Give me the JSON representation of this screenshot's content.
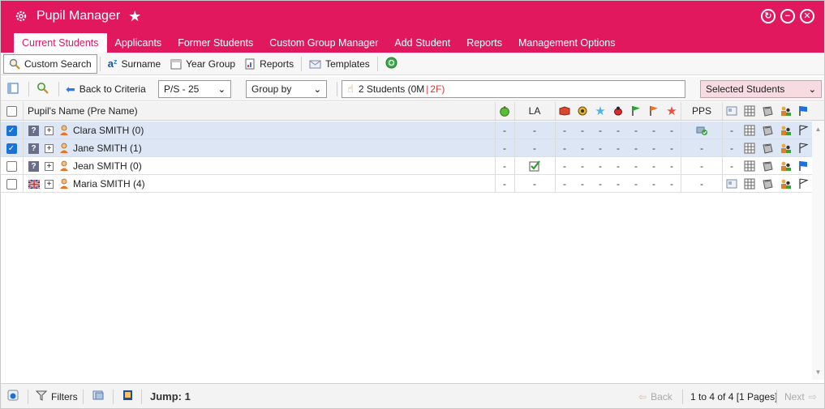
{
  "window": {
    "title": "Pupil Manager",
    "controls": [
      "refresh-icon",
      "minimize-icon",
      "close-icon"
    ]
  },
  "tabs": [
    {
      "label": "Current Students",
      "active": true
    },
    {
      "label": "Applicants"
    },
    {
      "label": "Former Students"
    },
    {
      "label": "Custom Group Manager"
    },
    {
      "label": "Add Student"
    },
    {
      "label": "Reports"
    },
    {
      "label": "Management Options"
    }
  ],
  "toolbar": {
    "custom_search": "Custom Search",
    "surname": "Surname",
    "year_group": "Year Group",
    "reports": "Reports",
    "templates": "Templates",
    "year_icon_text": "12"
  },
  "toolbar2": {
    "back_to_criteria": "Back to Criteria",
    "class_select": "P/S - 25",
    "group_by": "Group by",
    "student_count": "2 Students (0M",
    "student_sep": "|",
    "student_female": "2F)",
    "selected_students": "Selected Students"
  },
  "grid": {
    "name_header": "Pupil's Name (Pre Name)",
    "la_header": "LA",
    "pps_header": "PPS",
    "rows": [
      {
        "name": "Clara SMITH (0)",
        "checked": true,
        "flag": "question",
        "la_tick": false,
        "pps_icon": true,
        "photo": false,
        "end_flag": "outline"
      },
      {
        "name": "Jane SMITH (1)",
        "checked": true,
        "flag": "question",
        "la_tick": false,
        "pps_icon": false,
        "photo": false,
        "end_flag": "outline"
      },
      {
        "name": "Jean SMITH (0)",
        "checked": false,
        "flag": "question",
        "la_tick": true,
        "pps_icon": false,
        "photo": false,
        "end_flag": "blue"
      },
      {
        "name": "Maria SMITH (4)",
        "checked": false,
        "flag": "uk",
        "la_tick": false,
        "pps_icon": false,
        "photo": true,
        "end_flag": "outline"
      }
    ],
    "dash": "-"
  },
  "status": {
    "filters": "Filters",
    "jump": "Jump: 1",
    "back": "Back",
    "pages": "1 to 4 of 4 [1 Pages]",
    "next": "Next"
  },
  "colors": {
    "accent": "#e2185f",
    "selected_row": "#dde6f4",
    "selected_students_bg": "#f6dbe3"
  }
}
